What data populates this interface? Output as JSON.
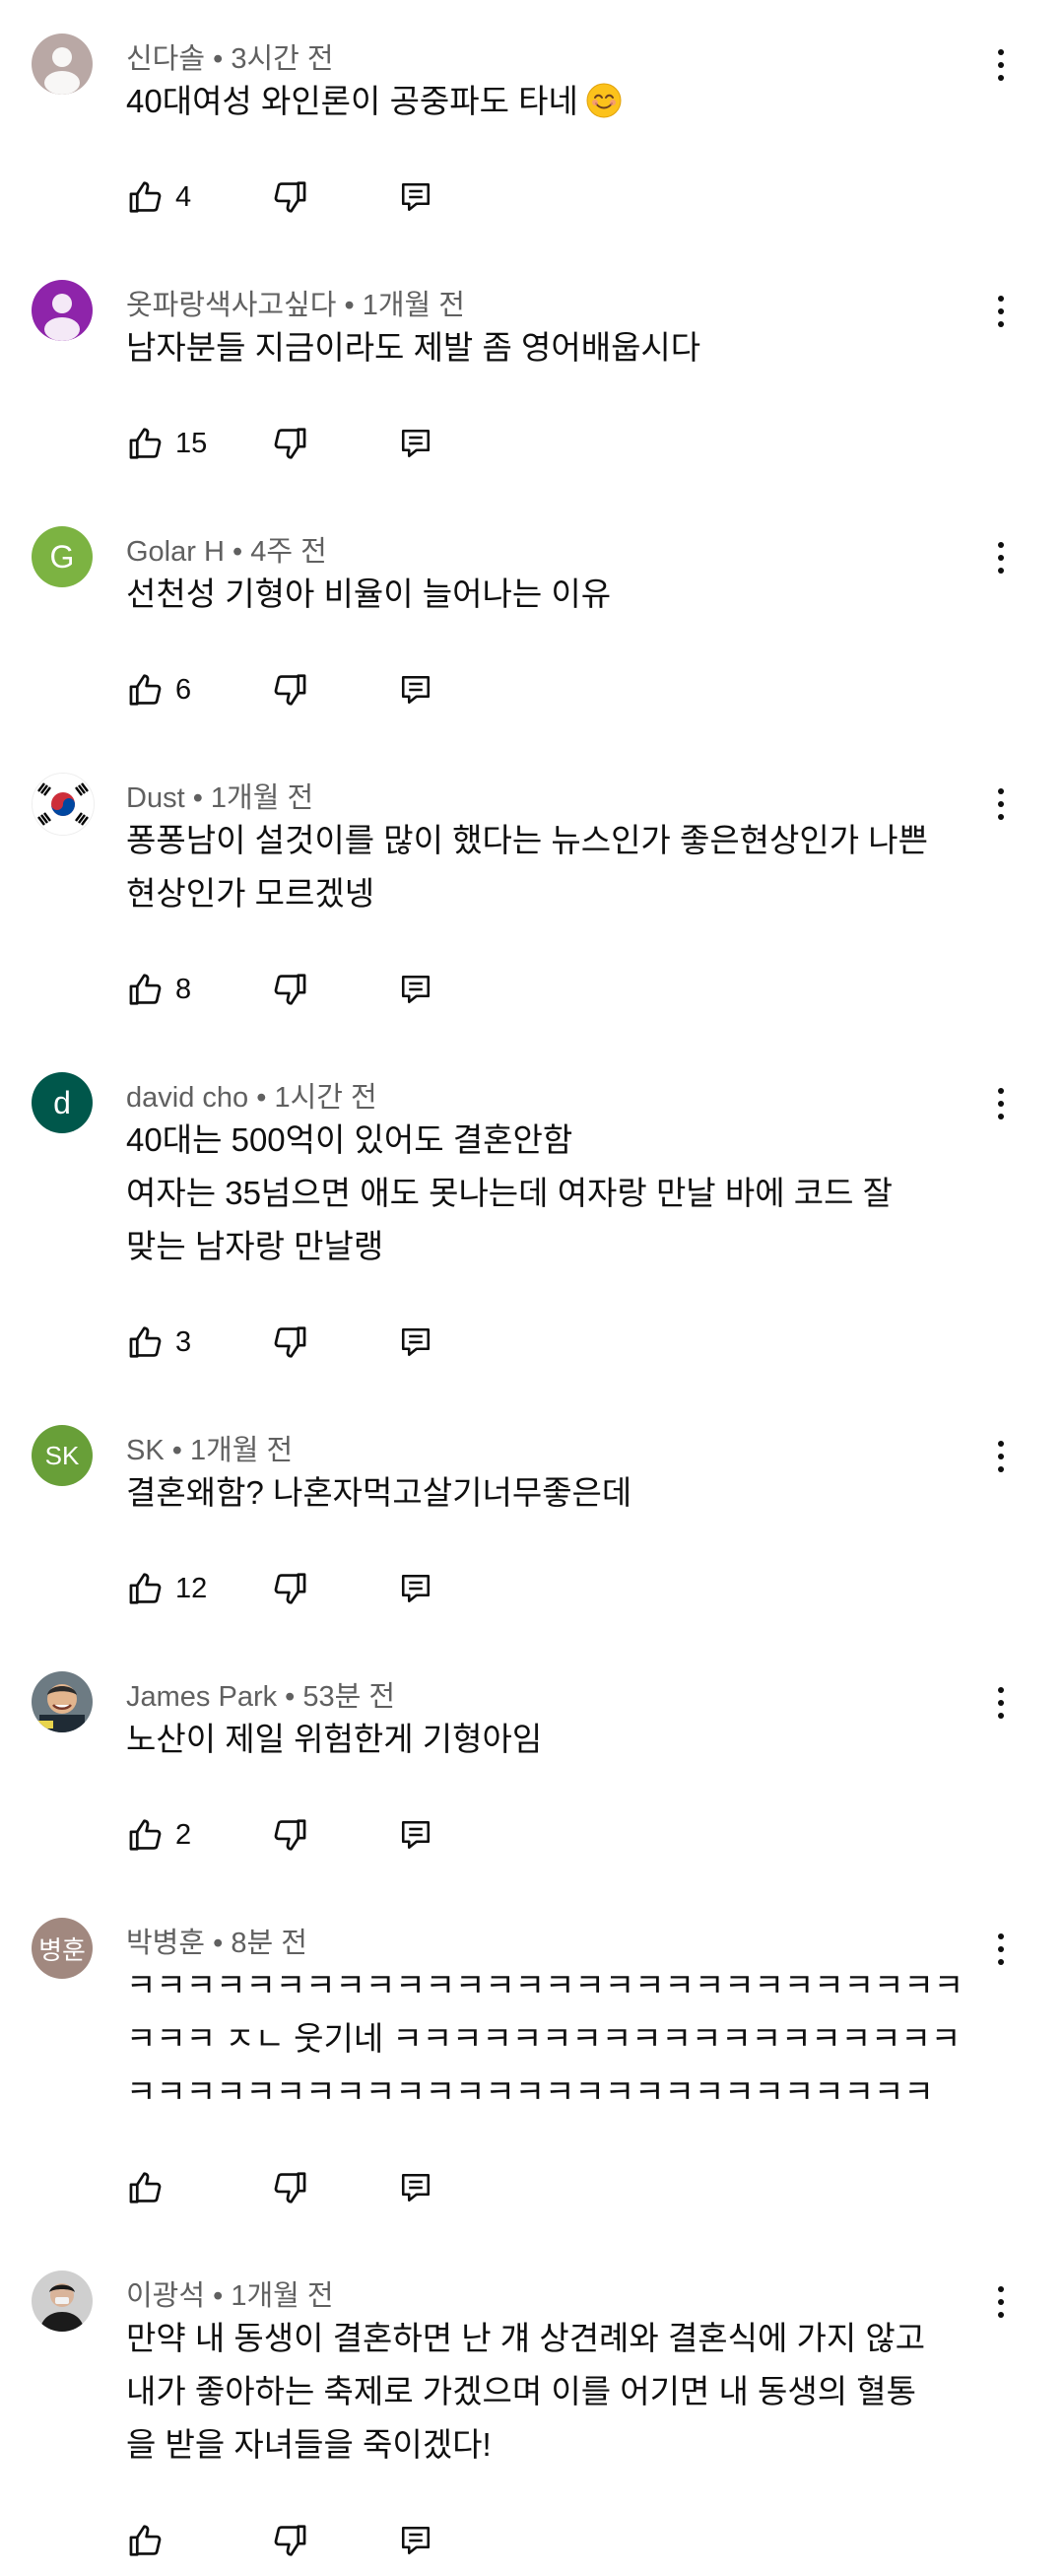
{
  "comments": [
    {
      "author": "신다솔",
      "time": "3시간 전",
      "text": "40대여성 와인론이 공중파도 타네",
      "emoji": "smiling-face-emoji",
      "likes": "4",
      "avatar_type": "default-person",
      "avatar_color": "#b9a8a5"
    },
    {
      "author": "옷파랑색사고싶다",
      "time": "1개월 전",
      "text": "남자분들 지금이라도 제발 좀 영어배웁시다",
      "likes": "15",
      "avatar_type": "default-person",
      "avatar_color": "#8e24aa"
    },
    {
      "author": "Golar H",
      "time": "4주 전",
      "text": "선천성 기형아 비율이 늘어나는 이유",
      "likes": "6",
      "avatar_type": "letter",
      "avatar_letter": "G",
      "avatar_color": "#7cb342"
    },
    {
      "author": "Dust",
      "time": "1개월 전",
      "text": "퐁퐁남이 설것이를 많이 했다는 뉴스인가 좋은현상인가 나쁜\n현상인가 모르겠넹",
      "likes": "8",
      "avatar_type": "flag"
    },
    {
      "author": "david cho",
      "time": "1시간 전",
      "text": "40대는 500억이 있어도 결혼안함\n여자는 35넘으면 애도 못나는데 여자랑 만날 바에 코드 잘\n맞는 남자랑 만날랭",
      "likes": "3",
      "avatar_type": "letter",
      "avatar_letter": "d",
      "avatar_color": "#00574b"
    },
    {
      "author": "SK",
      "time": "1개월 전",
      "text": "결혼왜함? 나혼자먹고살기너무좋은데",
      "likes": "12",
      "avatar_type": "letter",
      "avatar_letter": "SK",
      "avatar_color": "#689f38"
    },
    {
      "author": "James Park",
      "time": "53분 전",
      "text": "노산이 제일 위험한게 기형아임",
      "likes": "2",
      "avatar_type": "photo-face"
    },
    {
      "author": "박병훈",
      "time": "8분 전",
      "text": "ㅋㅋㅋㅋㅋㅋㅋㅋㅋㅋㅋㅋㅋㅋㅋㅋㅋㅋㅋㅋㅋㅋㅋㅋㅋㅋㅋㅋ\nㅋㅋㅋ ㅈㄴ 웃기네 ㅋㅋㅋㅋㅋㅋㅋㅋㅋㅋㅋㅋㅋㅋㅋㅋㅋㅋㅋ\nㅋㅋㅋㅋㅋㅋㅋㅋㅋㅋㅋㅋㅋㅋㅋㅋㅋㅋㅋㅋㅋㅋㅋㅋㅋㅋㅋ",
      "likes": "",
      "avatar_type": "letter",
      "avatar_letter": "병훈",
      "avatar_color": "#a1887f"
    },
    {
      "author": "이광석",
      "time": "1개월 전",
      "text": "만약 내 동생이 결혼하면 난 걔 상견례와 결혼식에 가지 않고\n내가 좋아하는 축제로 가겠으며 이를 어기면 내 동생의 혈통\n을 받을 자녀들을 죽이겠다!",
      "likes": "",
      "avatar_type": "photo-dark"
    }
  ]
}
